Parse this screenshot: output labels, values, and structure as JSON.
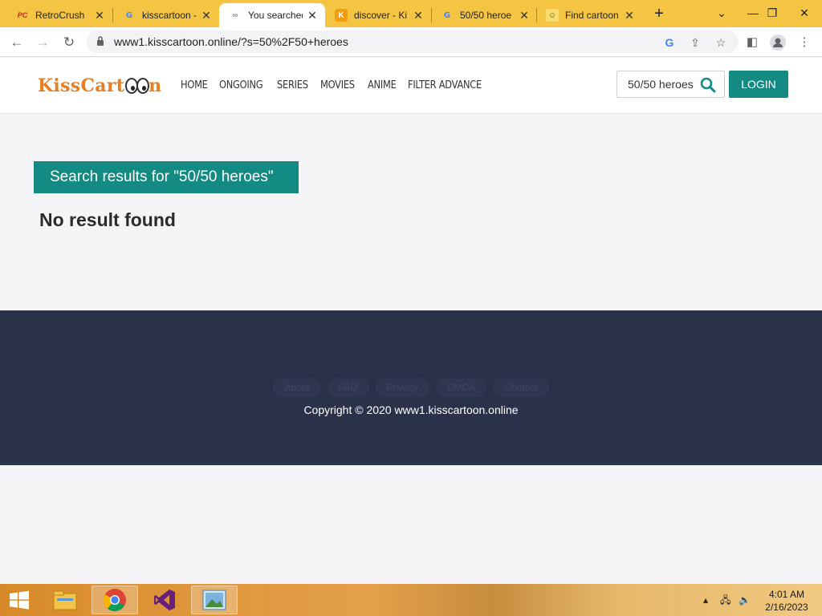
{
  "browser": {
    "tabs": [
      {
        "title": "RetroCrush",
        "favicon": "retrocrush-icon",
        "active": false
      },
      {
        "title": "kisscartoon -",
        "favicon": "google-icon",
        "active": false
      },
      {
        "title": "You searched",
        "favicon": "loading-icon",
        "active": true
      },
      {
        "title": "discover - Ki",
        "favicon": "kisscartoon-k-icon",
        "active": false
      },
      {
        "title": "50/50 heroe",
        "favicon": "google-icon",
        "active": false
      },
      {
        "title": "Find cartoon",
        "favicon": "cartoon-icon",
        "active": false
      }
    ],
    "url": "www1.kisscartoon.online/?s=50%2F50+heroes"
  },
  "site": {
    "logo_prefix": "KissCart",
    "logo_suffix": "n",
    "nav": [
      "HOME",
      "ONGOING",
      "SERIES",
      "MOVIES",
      "ANIME",
      "FILTER ADVANCE"
    ],
    "search_value": "50/50 heroes",
    "login_label": "LOGIN",
    "accent_color": "#138b82"
  },
  "main": {
    "banner": "Search results for \"50/50 heroes\"",
    "message": "No result found"
  },
  "footer": {
    "links": [
      "About",
      "FAQ",
      "Privacy",
      "DMCA",
      "Contact"
    ],
    "copyright": "Copyright © 2020 www1.kisscartoon.online",
    "bg_color": "#2a324a"
  },
  "taskbar": {
    "time": "4:01 AM",
    "date": "2/16/2023"
  }
}
